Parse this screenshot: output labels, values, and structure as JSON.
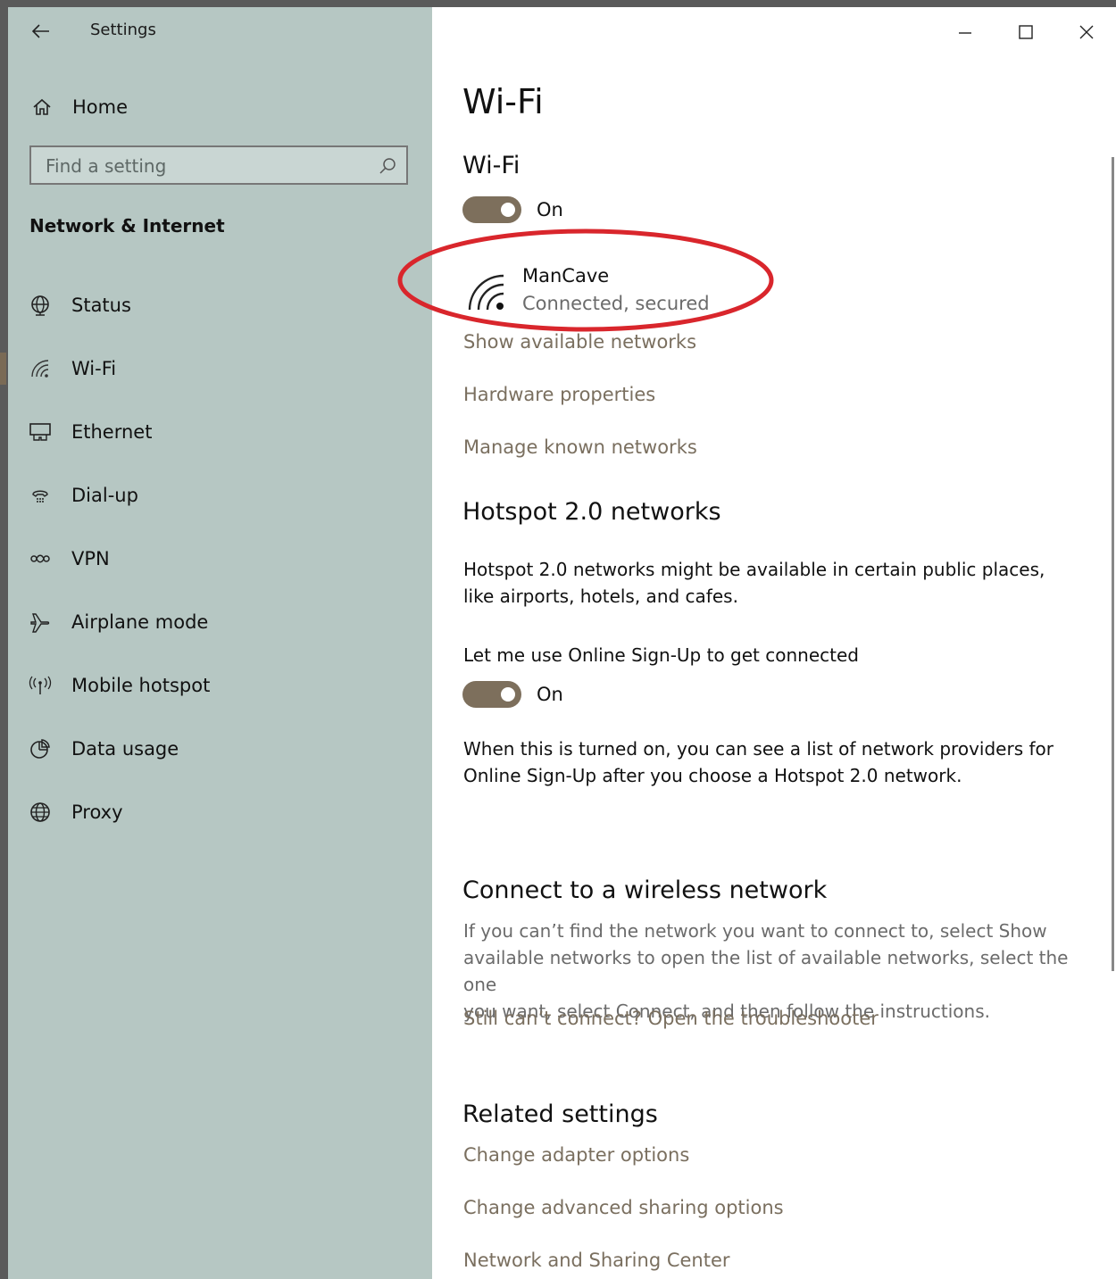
{
  "app": {
    "title": "Settings"
  },
  "sidebar": {
    "home_label": "Home",
    "search_placeholder": "Find a setting",
    "section_title": "Network & Internet",
    "items": [
      {
        "label": "Status",
        "icon": "globe-status-icon"
      },
      {
        "label": "Wi-Fi",
        "icon": "wifi-icon",
        "selected": true
      },
      {
        "label": "Ethernet",
        "icon": "ethernet-icon"
      },
      {
        "label": "Dial-up",
        "icon": "dialup-icon"
      },
      {
        "label": "VPN",
        "icon": "vpn-icon"
      },
      {
        "label": "Airplane mode",
        "icon": "airplane-icon"
      },
      {
        "label": "Mobile hotspot",
        "icon": "hotspot-icon"
      },
      {
        "label": "Data usage",
        "icon": "data-usage-icon"
      },
      {
        "label": "Proxy",
        "icon": "globe-icon"
      }
    ]
  },
  "main": {
    "page_title": "Wi-Fi",
    "wifi_section": {
      "title": "Wi-Fi",
      "toggle_label": "On",
      "toggle_on": true
    },
    "network": {
      "name": "ManCave",
      "status": "Connected, secured"
    },
    "links": {
      "show_networks": "Show available networks",
      "hardware": "Hardware properties",
      "manage": "Manage known networks"
    },
    "hotspot": {
      "title": "Hotspot 2.0 networks",
      "description_line1": "Hotspot 2.0 networks might be available in certain public places,",
      "description_line2": "like airports, hotels, and cafes.",
      "online_signup_label": "Let me use Online Sign-Up to get connected",
      "toggle_label": "On",
      "toggle_on": true,
      "note_line1": "When this is turned on, you can see a list of network providers for",
      "note_line2": "Online Sign-Up after you choose a Hotspot 2.0 network."
    },
    "connect": {
      "title": "Connect to a wireless network",
      "text_line1": "If you can’t find the network you want to connect to, select Show",
      "text_line2": "available networks to open the list of available networks, select the one",
      "text_line3": "you want, select Connect, and then follow the instructions.",
      "troubleshoot_link": "Still can’t connect? Open the troubleshooter"
    },
    "related": {
      "title": "Related settings",
      "links": [
        "Change adapter options",
        "Change advanced sharing options",
        "Network and Sharing Center"
      ]
    }
  },
  "colors": {
    "sidebar_bg": "#b6c7c3",
    "accent": "#7d6f5c",
    "link": "#7a6f5f",
    "highlight_ellipse": "#d9262c"
  }
}
